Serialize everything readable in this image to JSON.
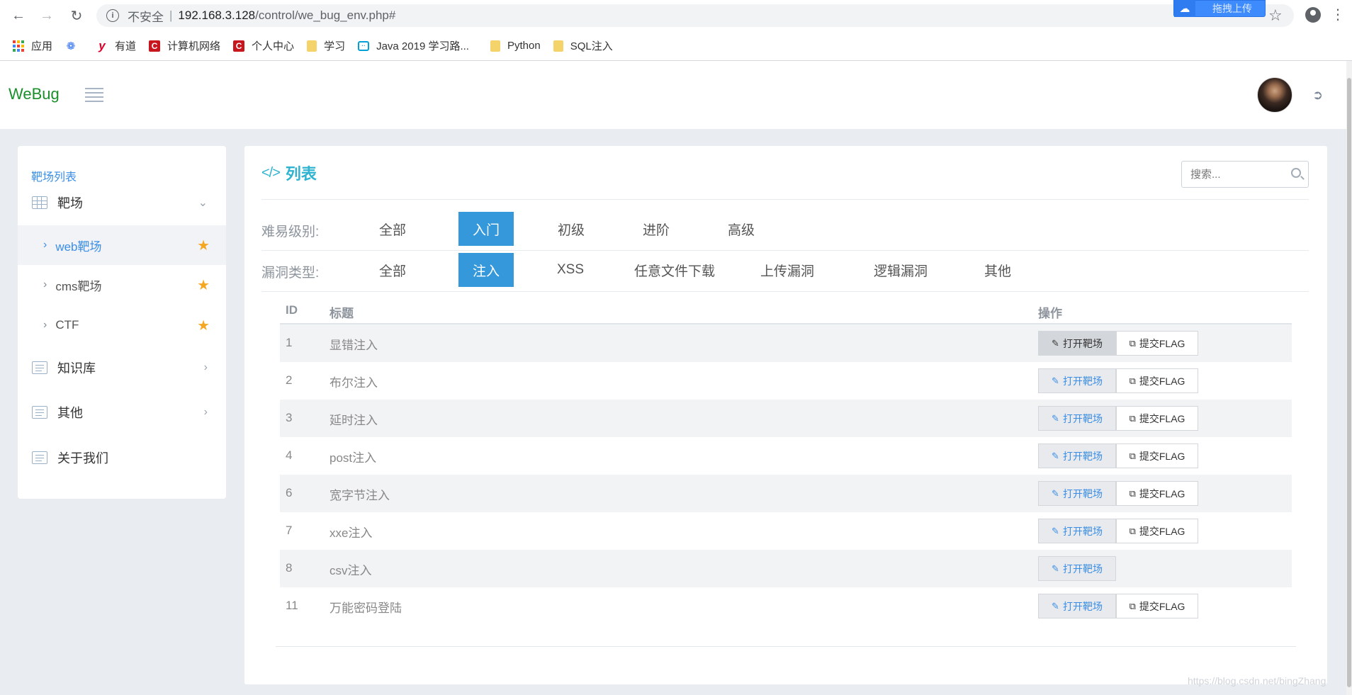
{
  "browser": {
    "insecure_label": "不安全",
    "url_host": "192.168.3.128",
    "url_path": "/control/we_bug_env.php#",
    "upload_button": "拖拽上传"
  },
  "bookmarks": [
    {
      "label": "应用",
      "icon": "apps-grid-icon"
    },
    {
      "label": "",
      "icon": "baidu-paw-icon"
    },
    {
      "label": "有道",
      "icon": "youdao-icon"
    },
    {
      "label": "计算机网络",
      "icon": "csdn-icon"
    },
    {
      "label": "个人中心",
      "icon": "csdn-icon"
    },
    {
      "label": "学习",
      "icon": "folder-icon"
    },
    {
      "label": "Java 2019 学习路...",
      "icon": "bilibili-icon"
    },
    {
      "label": "Python",
      "icon": "folder-icon"
    },
    {
      "label": "SQL注入",
      "icon": "folder-icon"
    }
  ],
  "app": {
    "logo": "WeBug"
  },
  "sidebar": {
    "heading": "靶场列表",
    "group": "靶场",
    "sub_items": [
      {
        "label": "web靶场",
        "active": true
      },
      {
        "label": "cms靶场",
        "active": false
      },
      {
        "label": "CTF",
        "active": false
      }
    ],
    "items": [
      {
        "label": "知识库"
      },
      {
        "label": "其他"
      },
      {
        "label": "关于我们"
      }
    ]
  },
  "main": {
    "title": "列表",
    "search_placeholder": "搜索...",
    "difficulty": {
      "label": "难易级别:",
      "options": [
        "全部",
        "入门",
        "初级",
        "进阶",
        "高级"
      ],
      "selected": "入门"
    },
    "vuln_type": {
      "label": "漏洞类型:",
      "options": [
        "全部",
        "注入",
        "XSS",
        "任意文件下载",
        "上传漏洞",
        "逻辑漏洞",
        "其他"
      ],
      "selected": "注入"
    },
    "table": {
      "headers": {
        "id": "ID",
        "title": "标题",
        "action": "操作"
      },
      "open_label": "打开靶场",
      "flag_label": "提交FLAG",
      "rows": [
        {
          "id": "1",
          "title": "显错注入",
          "has_flag": true
        },
        {
          "id": "2",
          "title": "布尔注入",
          "has_flag": true
        },
        {
          "id": "3",
          "title": "延时注入",
          "has_flag": true
        },
        {
          "id": "4",
          "title": "post注入",
          "has_flag": true
        },
        {
          "id": "6",
          "title": "宽字节注入",
          "has_flag": true
        },
        {
          "id": "7",
          "title": "xxe注入",
          "has_flag": true
        },
        {
          "id": "8",
          "title": "csv注入",
          "has_flag": false
        },
        {
          "id": "11",
          "title": "万能密码登陆",
          "has_flag": true
        }
      ]
    }
  },
  "watermark": "https://blog.csdn.net/bingZhang",
  "colors": {
    "accent": "#3498db",
    "link": "#3a8ee6",
    "logo": "#1a8f2b",
    "title": "#2fb3d0",
    "star": "#f5a623"
  }
}
